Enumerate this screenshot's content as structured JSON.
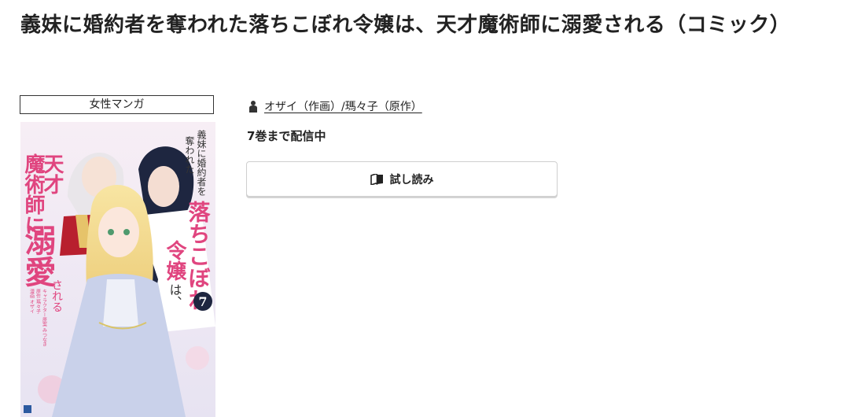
{
  "page": {
    "title": "義妹に婚約者を奪われた落ちこぼれ令嬢は、天才魔術師に溺愛される（コミック）"
  },
  "genre": {
    "label": "女性マンガ"
  },
  "cover": {
    "title_vertical_left": "天才魔術師に溺愛される",
    "title_vertical_right": "義妹に婚約者を奪われた落ちこぼれ令嬢は、",
    "volume_number": "7",
    "credits": [
      "漫画 オザイ",
      "原作 瑪々子",
      "キャラクター原案 みつなき"
    ],
    "colors": {
      "pink": "#e0457f",
      "navy": "#1e2640",
      "blonde": "#f2d98b",
      "dress": "#c9d1ea"
    }
  },
  "book": {
    "author_text": "オザイ（作画）/瑪々子（原作）",
    "author_icon": "person-icon",
    "volume_status": "7巻まで配信中"
  },
  "actions": {
    "trial_label": "試し読み",
    "trial_icon": "open-book-icon"
  }
}
